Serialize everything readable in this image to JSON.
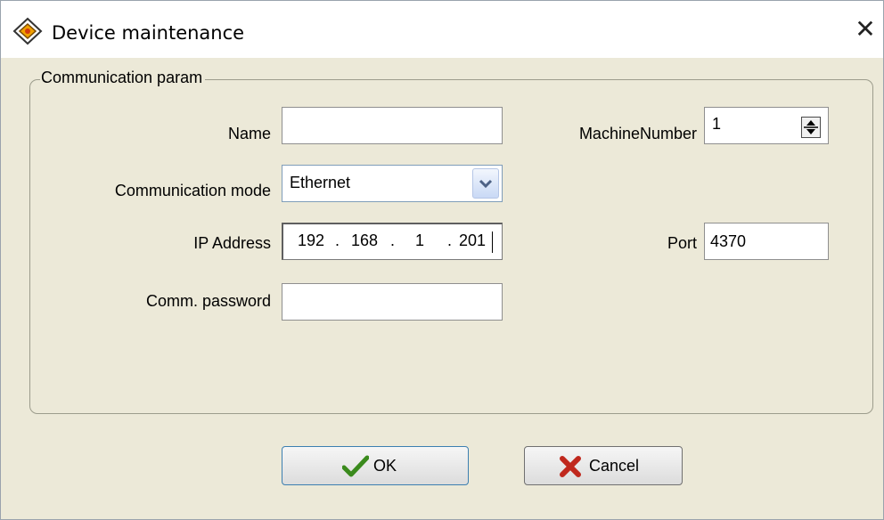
{
  "window": {
    "title": "Device maintenance",
    "close_glyph": "✕",
    "icon": "app-diamond-icon"
  },
  "group": {
    "legend": "Communication param"
  },
  "fields": {
    "name": {
      "label": "Name",
      "value": ""
    },
    "comm_mode": {
      "label": "Communication mode",
      "value": "Ethernet"
    },
    "ip": {
      "label": "IP Address",
      "octets": [
        "192",
        "168",
        "1",
        "201"
      ],
      "separator": "."
    },
    "password": {
      "label": "Comm. password",
      "value": ""
    },
    "machine_number": {
      "label": "MachineNumber",
      "value": "1"
    },
    "port": {
      "label": "Port",
      "value": "4370"
    }
  },
  "buttons": {
    "ok": {
      "label": "OK",
      "icon": "checkmark-icon",
      "color": "#3a8a1c"
    },
    "cancel": {
      "label": "Cancel",
      "icon": "x-cross-icon",
      "color": "#c0281d"
    }
  },
  "colors": {
    "dialog_bg": "#ece9d8",
    "titlebar_bg": "#ffffff",
    "combo_border": "#7f9db9"
  }
}
